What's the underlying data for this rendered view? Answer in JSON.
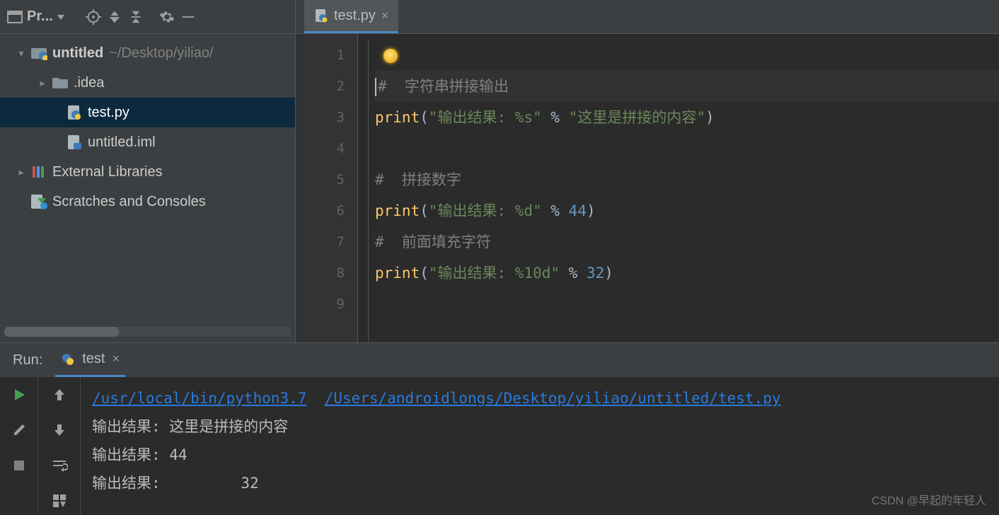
{
  "project": {
    "panel_label": "Pr...",
    "root": {
      "name": "untitled",
      "path": "~/Desktop/yiliao/"
    },
    "items": [
      {
        "label": ".idea"
      },
      {
        "label": "test.py"
      },
      {
        "label": "untitled.iml"
      }
    ],
    "external_libraries": "External Libraries",
    "scratches": "Scratches and Consoles"
  },
  "editor": {
    "tab": "test.py",
    "lines": [
      "1",
      "2",
      "3",
      "4",
      "5",
      "6",
      "7",
      "8",
      "9"
    ],
    "l2_comment": "#  字符串拼接输出",
    "l3_fn": "print",
    "l3_str1": "\"输出结果: %s\"",
    "l3_op": " % ",
    "l3_str2": "\"这里是拼接的内容\"",
    "l5_comment": "#  拼接数字",
    "l6_fn": "print",
    "l6_str": "\"输出结果: %d\"",
    "l6_op": " % ",
    "l6_num": "44",
    "l7_comment": "#  前面填充字符",
    "l8_fn": "print",
    "l8_str": "\"输出结果: %10d\"",
    "l8_op": " % ",
    "l8_num": "32"
  },
  "run": {
    "label": "Run:",
    "tab": "test",
    "cmd_path1": "/usr/local/bin/python3.7",
    "cmd_path2": "/Users/androidlongs/Desktop/yiliao/untitled/test.py",
    "out1": "输出结果: 这里是拼接的内容",
    "out2": "输出结果: 44",
    "out3": "输出结果:         32"
  },
  "watermark": "CSDN @早起的年轻人"
}
